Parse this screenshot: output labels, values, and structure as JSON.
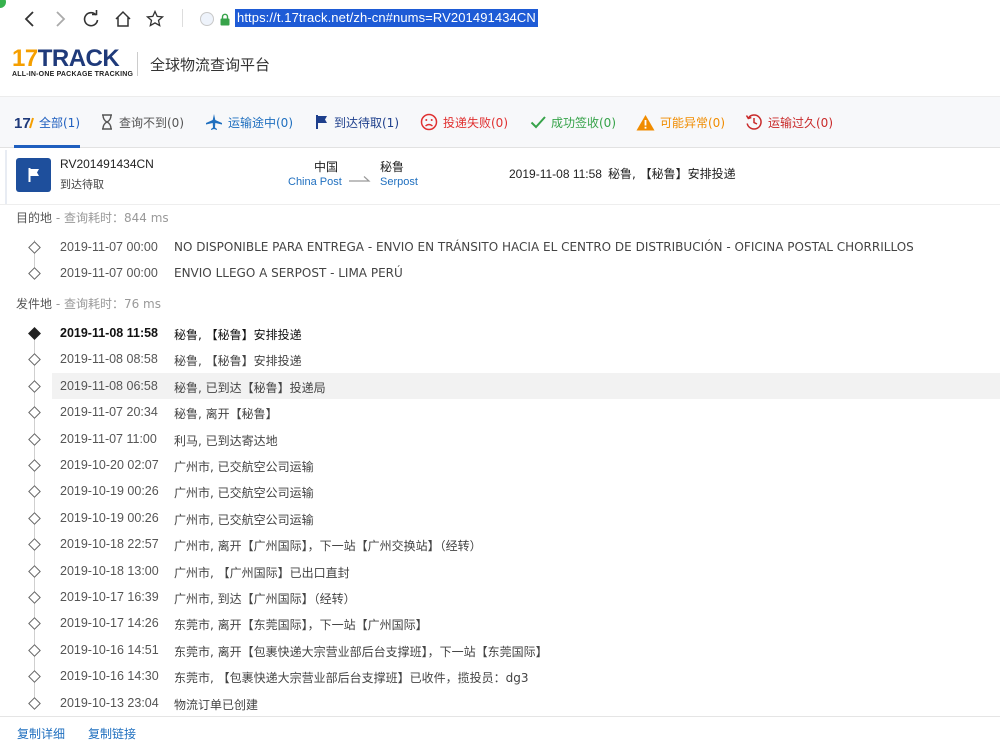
{
  "browser": {
    "url": "https://t.17track.net/zh-cn#nums=RV201491434CN"
  },
  "site": {
    "logo_main_a": "17",
    "logo_main_b": "TRACK",
    "logo_tagline": "ALL-IN-ONE PACKAGE TRACKING",
    "title": "全球物流查询平台"
  },
  "tabs": [
    {
      "label": "全部(1)",
      "icon": "17track-mark-icon",
      "color": "#1f5fbf"
    },
    {
      "label": "查询不到(0)",
      "icon": "hourglass-icon",
      "color": "#666666"
    },
    {
      "label": "运输途中(0)",
      "icon": "plane-icon",
      "color": "#1f6fbf"
    },
    {
      "label": "到达待取(1)",
      "icon": "flag-icon",
      "color": "#1e3f8c"
    },
    {
      "label": "投递失败(0)",
      "icon": "sad-face-icon",
      "color": "#e03131"
    },
    {
      "label": "成功签收(0)",
      "icon": "checkmark-icon",
      "color": "#37a34a"
    },
    {
      "label": "可能异常(0)",
      "icon": "warning-icon",
      "color": "#f08c00"
    },
    {
      "label": "运输过久(0)",
      "icon": "clock-history-icon",
      "color": "#c92a2a"
    }
  ],
  "shipment": {
    "tracking_number": "RV201491434CN",
    "status": "到达待取",
    "origin_country": "中国",
    "origin_carrier": "China Post",
    "dest_country": "秘鲁",
    "dest_carrier": "Serpost",
    "latest_time": "2019-11-08 11:58",
    "latest_desc": "秘鲁, 【秘鲁】安排投递"
  },
  "destination_section": {
    "title": "目的地",
    "meta": " - 查询耗时：844 ms",
    "events": [
      {
        "time": "2019-11-07 00:00",
        "desc": "NO DISPONIBLE PARA ENTREGA - ENVIO EN TRÁNSITO HACIA EL CENTRO DE DISTRIBUCIÓN - OFICINA POSTAL CHORRILLOS"
      },
      {
        "time": "2019-11-07 00:00",
        "desc": "ENVIO LLEGO A SERPOST - LIMA PERÚ"
      }
    ]
  },
  "origin_section": {
    "title": "发件地",
    "meta": " - 查询耗时：76 ms",
    "events": [
      {
        "time": "2019-11-08 11:58",
        "desc": "秘鲁, 【秘鲁】安排投递"
      },
      {
        "time": "2019-11-08 08:58",
        "desc": "秘鲁, 【秘鲁】安排投递"
      },
      {
        "time": "2019-11-08 06:58",
        "desc": "秘鲁, 已到达【秘鲁】投递局"
      },
      {
        "time": "2019-11-07 20:34",
        "desc": "秘鲁, 离开【秘鲁】"
      },
      {
        "time": "2019-11-07 11:00",
        "desc": "利马, 已到达寄达地"
      },
      {
        "time": "2019-10-20 02:07",
        "desc": "广州市, 已交航空公司运输"
      },
      {
        "time": "2019-10-19 00:26",
        "desc": "广州市, 已交航空公司运输"
      },
      {
        "time": "2019-10-19 00:26",
        "desc": "广州市, 已交航空公司运输"
      },
      {
        "time": "2019-10-18 22:57",
        "desc": "广州市, 离开【广州国际】，下一站【广州交换站】（经转）"
      },
      {
        "time": "2019-10-18 13:00",
        "desc": "广州市, 【广州国际】已出口直封"
      },
      {
        "time": "2019-10-17 16:39",
        "desc": "广州市, 到达【广州国际】（经转）"
      },
      {
        "time": "2019-10-17 14:26",
        "desc": "东莞市, 离开【东莞国际】，下一站【广州国际】"
      },
      {
        "time": "2019-10-16 14:51",
        "desc": "东莞市, 离开【包裹快递大宗营业部后台支撑班】，下一站【东莞国际】"
      },
      {
        "time": "2019-10-16 14:30",
        "desc": "东莞市, 【包裹快递大宗营业部后台支撑班】已收件，揽投员：dg3"
      },
      {
        "time": "2019-10-13 23:04",
        "desc": "物流订单已创建"
      }
    ]
  },
  "footer": {
    "copy_details": "复制详细",
    "copy_link": "复制链接"
  }
}
